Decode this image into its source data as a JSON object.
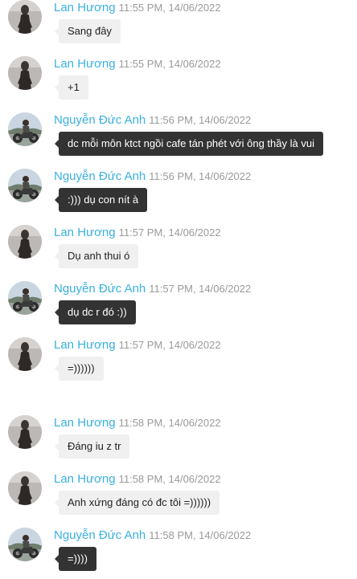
{
  "messages": [
    {
      "sender": "Lan Hương",
      "avatar": "woman-avatar",
      "time": "11:55 PM, 14/06/2022",
      "text": "Sang đây",
      "style": "light"
    },
    {
      "sender": "Lan Hương",
      "avatar": "woman-avatar",
      "time": "11:55 PM, 14/06/2022",
      "text": "+1",
      "style": "light"
    },
    {
      "sender": "Nguyễn Đức Anh",
      "avatar": "motorbike-avatar",
      "time": "11:56 PM, 14/06/2022",
      "text": "dc mỗi môn ktct ngồi cafe tán phét với ông thầy là vui",
      "style": "dark"
    },
    {
      "sender": "Nguyễn Đức Anh",
      "avatar": "motorbike-avatar",
      "time": "11:56 PM, 14/06/2022",
      "text": ":))) dụ con nít à",
      "style": "dark"
    },
    {
      "sender": "Lan Hương",
      "avatar": "woman-avatar",
      "time": "11:57 PM, 14/06/2022",
      "text": "Dụ anh thui ó",
      "style": "light"
    },
    {
      "sender": "Nguyễn Đức Anh",
      "avatar": "motorbike-avatar",
      "time": "11:57 PM, 14/06/2022",
      "text": "dụ dc r đó :))",
      "style": "dark"
    },
    {
      "sender": "Lan Hương",
      "avatar": "woman-avatar",
      "time": "11:57 PM, 14/06/2022",
      "text": "=))))))",
      "style": "light"
    },
    {
      "sender": "Lan Hương",
      "avatar": "woman-avatar",
      "time": "11:58 PM, 14/06/2022",
      "text": "Đáng iu z tr",
      "style": "light"
    },
    {
      "sender": "Lan Hương",
      "avatar": "woman-avatar",
      "time": "11:58 PM, 14/06/2022",
      "text": "Anh xứng đáng có đc tôi =))))))",
      "style": "light"
    },
    {
      "sender": "Nguyễn Đức Anh",
      "avatar": "motorbike-avatar",
      "time": "11:58 PM, 14/06/2022",
      "text": "=))))",
      "style": "dark"
    }
  ],
  "colors": {
    "name": "#3ab0e0",
    "time": "#9a9a9a",
    "bubble_light": "#f0f0f0",
    "bubble_dark": "#333333"
  }
}
